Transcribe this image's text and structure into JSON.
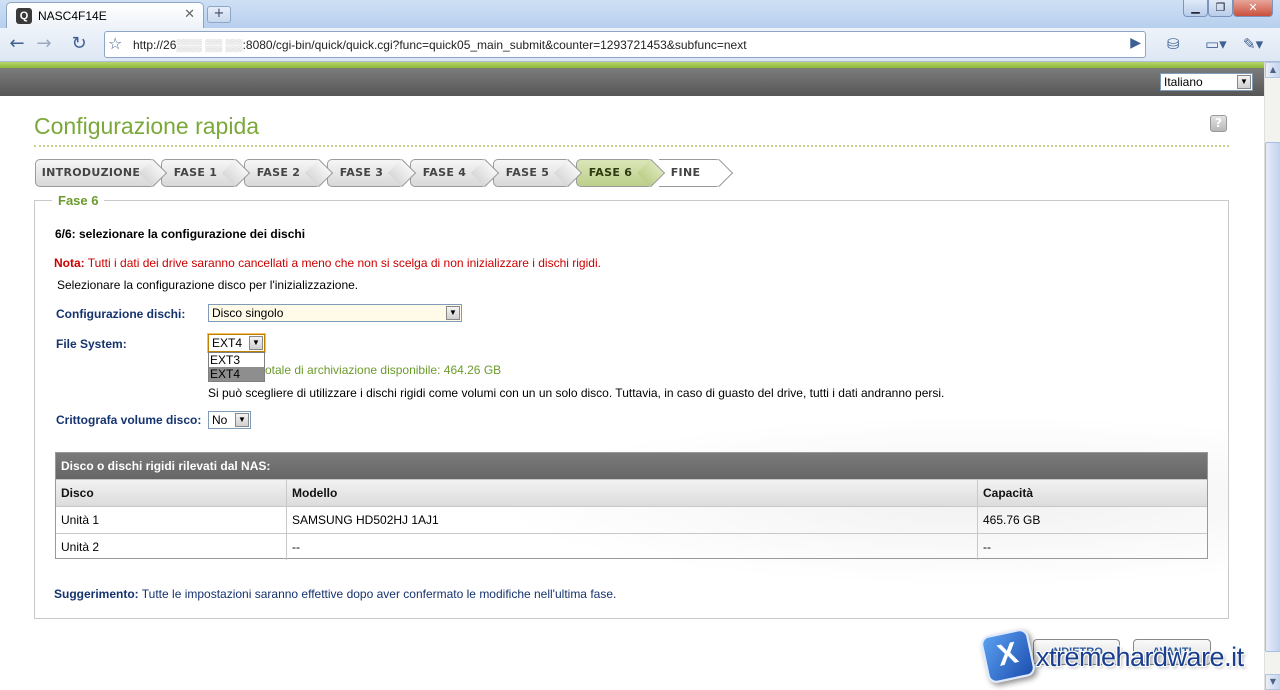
{
  "browser": {
    "tab_title": "NASC4F14E",
    "favicon_letter": "Q",
    "new_tab": "+",
    "url_prefix": "http://26",
    "url_redacted": "▒▒▒ ▒▒ ▒▒",
    "url_rest": ":8080/cgi-bin/quick/quick.cgi?func=quick05_main_submit&counter=1293721453&subfunc=next"
  },
  "language": {
    "selected": "Italiano"
  },
  "page": {
    "title": "Configurazione rapida",
    "help": "?"
  },
  "steps": [
    {
      "label": "INTRODUZIONE"
    },
    {
      "label": "FASE 1"
    },
    {
      "label": "FASE 2"
    },
    {
      "label": "FASE 3"
    },
    {
      "label": "FASE 4"
    },
    {
      "label": "FASE 5"
    },
    {
      "label": "FASE 6",
      "active": true
    },
    {
      "label": "FINE"
    }
  ],
  "form": {
    "legend": "Fase 6",
    "heading": "6/6: selezionare la configurazione dei dischi",
    "note_label": "Nota:",
    "note_text": " Tutti i dati dei drive saranno cancellati a meno che non si scelga di non inizializzare i dischi rigidi.",
    "instruction": "Selezionare la configurazione disco per l'inizializzazione.",
    "disk_config_label": "Configurazione dischi:",
    "disk_config_value": "Disco singolo",
    "filesystem_label": "File System:",
    "filesystem_value": "EXT4",
    "filesystem_options": [
      "EXT3",
      "EXT4"
    ],
    "capacity_text_visible": "otale di archiviazione disponibile: 464.26 GB",
    "single_disk_info": "Si può scegliere di utilizzare i dischi rigidi come volumi con un un solo disco. Tuttavia, in caso di guasto del drive, tutti i dati andranno persi.",
    "encrypt_label": "Crittografa volume disco:",
    "encrypt_value": "No"
  },
  "disk_table": {
    "caption": "Disco o dischi rigidi rilevati dal NAS:",
    "headers": [
      "Disco",
      "Modello",
      "Capacità"
    ],
    "rows": [
      [
        "Unità 1",
        "SAMSUNG HD502HJ 1AJ1",
        "465.76 GB"
      ],
      [
        "Unità 2",
        "--",
        "--"
      ]
    ]
  },
  "hint": {
    "label": "Suggerimento:",
    "text": " Tutte le impostazioni saranno effettive dopo aver confermato le modifiche nell'ultima fase."
  },
  "buttons": {
    "back": "INDIETRO",
    "next": "AVANTI"
  },
  "watermark": {
    "brand": "xtremehardware.it",
    "logo_letter": "X"
  },
  "colors": {
    "accent_green": "#7ba83a",
    "label_blue": "#15336e",
    "note_red": "#cc0000"
  }
}
